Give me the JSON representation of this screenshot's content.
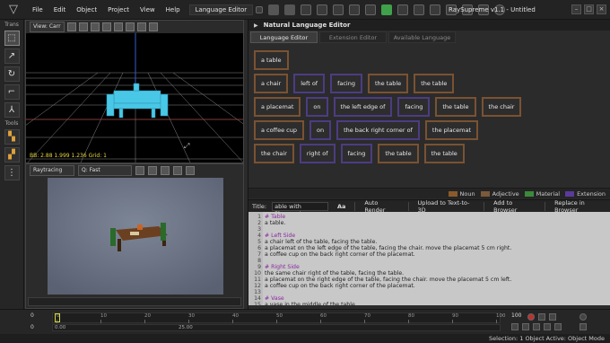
{
  "menubar": {
    "items": [
      "File",
      "Edit",
      "Object",
      "Project",
      "View",
      "Help"
    ],
    "mode_dropdown": "Language Editor",
    "app_title": "RaySupreme v1.1 - Untitled"
  },
  "left_tools": {
    "label_top": "Trans",
    "label_mid": "Tools"
  },
  "viewport": {
    "view_select": "View: Carr",
    "status": "BB: 2.88 1.999 1.236  Grid: 1"
  },
  "render_panel": {
    "mode_select": "Raytracing",
    "quality_select": "Q:  Fast"
  },
  "nle": {
    "title": "Natural Language Editor",
    "tabs": [
      "Language Editor",
      "Extension Editor",
      "Available Language"
    ],
    "rows": [
      [
        {
          "t": "a table",
          "k": "noun"
        }
      ],
      [
        {
          "t": "a chair",
          "k": "noun"
        },
        {
          "t": "left of",
          "k": "ext"
        },
        {
          "t": "facing",
          "k": "ext"
        },
        {
          "t": "the table",
          "k": "noun"
        },
        {
          "t": "the table",
          "k": "noun"
        }
      ],
      [
        {
          "t": "a placemat",
          "k": "noun"
        },
        {
          "t": "on",
          "k": "ext"
        },
        {
          "t": "the left edge of",
          "k": "ext"
        },
        {
          "t": "facing",
          "k": "ext"
        },
        {
          "t": "the table",
          "k": "noun"
        },
        {
          "t": "the chair",
          "k": "noun"
        }
      ],
      [
        {
          "t": "a coffee cup",
          "k": "noun"
        },
        {
          "t": "on",
          "k": "ext"
        },
        {
          "t": "the back right corner of",
          "k": "ext"
        },
        {
          "t": "the placemat",
          "k": "noun"
        }
      ],
      [
        {
          "t": "the chair",
          "k": "noun"
        },
        {
          "t": "right of",
          "k": "ext"
        },
        {
          "t": "facing",
          "k": "ext"
        },
        {
          "t": "the table",
          "k": "noun"
        },
        {
          "t": "the table",
          "k": "noun"
        }
      ]
    ],
    "legend": [
      {
        "label": "Noun",
        "color": "#8a5a2a"
      },
      {
        "label": "Adjective",
        "color": "#7a5a3a"
      },
      {
        "label": "Material",
        "color": "#3a8a3a"
      },
      {
        "label": "Extension",
        "color": "#5a3a9a"
      }
    ]
  },
  "editor_bar": {
    "title_label": "Title:",
    "title_value": "able with Placemats",
    "auto_render": "Auto Render",
    "upload": "Upload to Text-to-3D",
    "add_browser": "Add to Browser",
    "replace_browser": "Replace in Browser"
  },
  "code": [
    {
      "n": "1",
      "t": "# Table",
      "c": true
    },
    {
      "n": "2",
      "t": "a table.",
      "c": false
    },
    {
      "n": "3",
      "t": "",
      "c": false
    },
    {
      "n": "4",
      "t": "# Left Side",
      "c": true
    },
    {
      "n": "5",
      "t": "a chair left of the table, facing the table.",
      "c": false
    },
    {
      "n": "6",
      "t": "a placemat on the left edge of the table, facing the chair. move the placemat 5 cm right.",
      "c": false
    },
    {
      "n": "7",
      "t": "a coffee cup on the back right corner of the placemat.",
      "c": false
    },
    {
      "n": "8",
      "t": "",
      "c": false
    },
    {
      "n": "9",
      "t": "# Right Side",
      "c": true
    },
    {
      "n": "10",
      "t": "the same chair right of the table, facing the table.",
      "c": false
    },
    {
      "n": "11",
      "t": "a placemat on the right edge of the table, facing the chair. move the placemat 5 cm left.",
      "c": false
    },
    {
      "n": "12",
      "t": "a coffee cup on the back right corner of the placemat.",
      "c": false
    },
    {
      "n": "13",
      "t": "",
      "c": false
    },
    {
      "n": "14",
      "t": "# Vase",
      "c": true
    },
    {
      "n": "15",
      "t": "a vase in the middle of the table.",
      "c": false
    }
  ],
  "timeline": {
    "frame_top": "0",
    "frame_bottom": "0",
    "ticks": [
      "0",
      "10",
      "20",
      "30",
      "40",
      "50",
      "60",
      "70",
      "80",
      "90",
      "100"
    ],
    "range_start": "0.00",
    "range_end": "25.00",
    "end_frame": "100"
  },
  "status_bar": "Selection: 1 Object  Active: Object Mode"
}
